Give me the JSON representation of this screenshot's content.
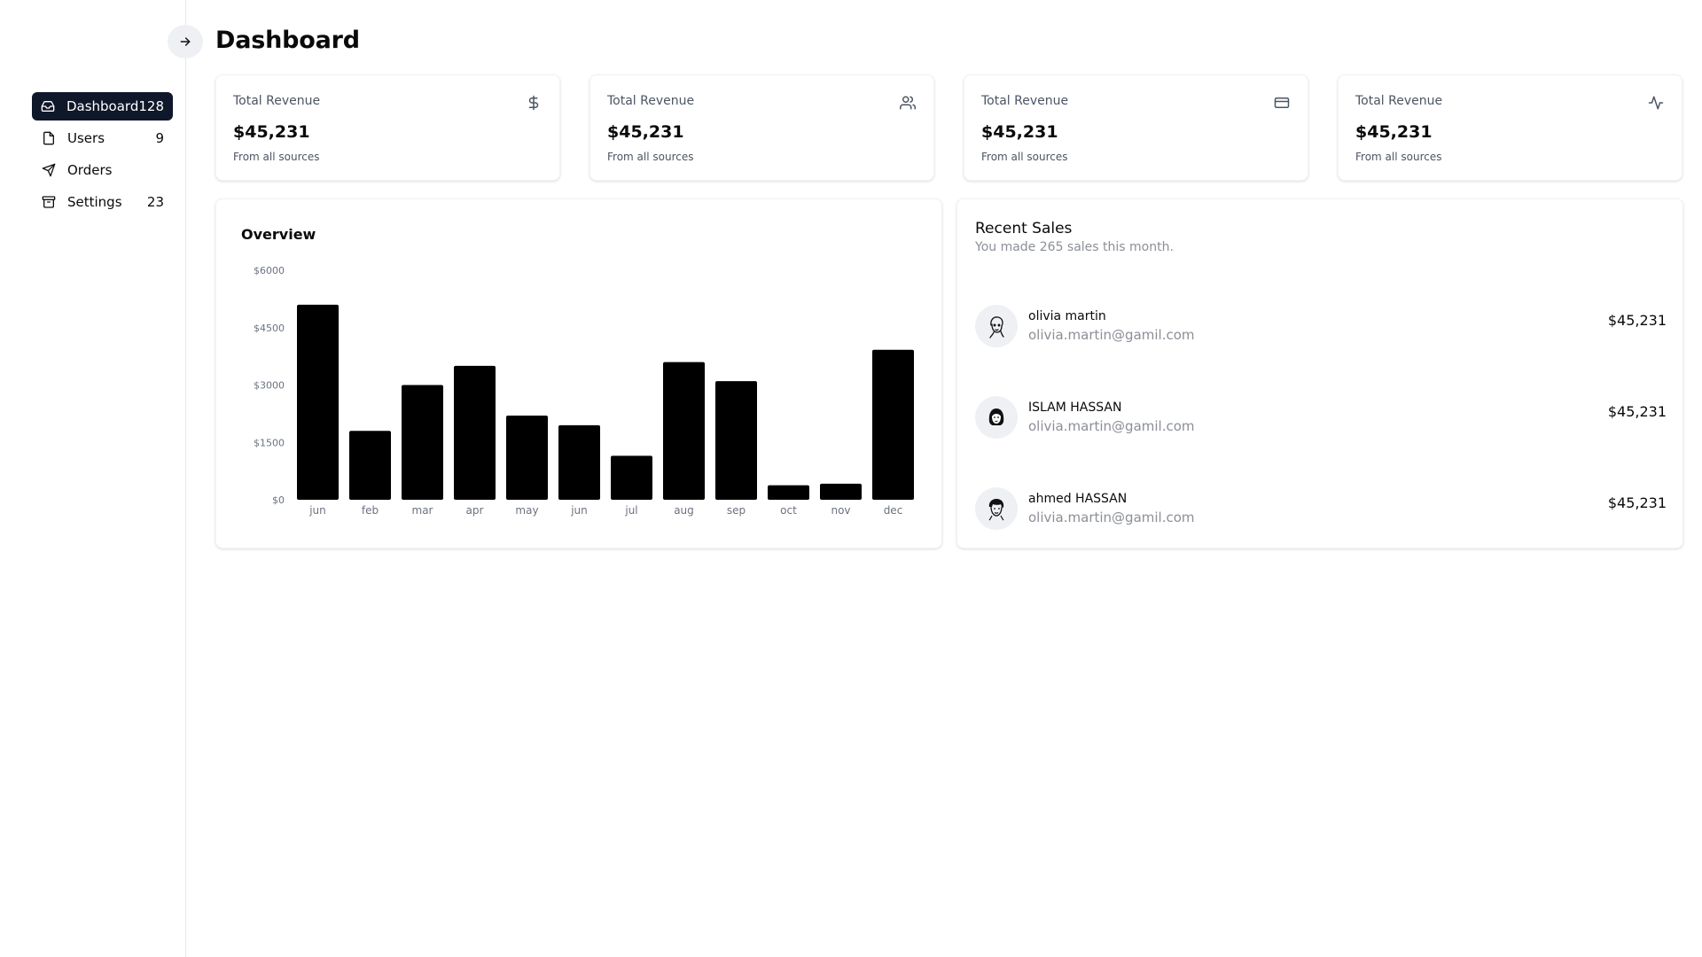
{
  "page": {
    "title": "Dashboard"
  },
  "sidebar": {
    "collapse_icon": "arrow-right-icon",
    "items": [
      {
        "label": "Dashboard",
        "count": "128",
        "icon": "inbox-icon",
        "active": true
      },
      {
        "label": "Users",
        "count": "9",
        "icon": "file-icon",
        "active": false
      },
      {
        "label": "Orders",
        "count": "",
        "icon": "send-icon",
        "active": false
      },
      {
        "label": "Settings",
        "count": "23",
        "icon": "archive-icon",
        "active": false
      }
    ]
  },
  "stats": [
    {
      "title": "Total Revenue",
      "value": "$45,231",
      "sub": "From all sources",
      "icon": "dollar-icon"
    },
    {
      "title": "Total Revenue",
      "value": "$45,231",
      "sub": "From all sources",
      "icon": "users-icon"
    },
    {
      "title": "Total Revenue",
      "value": "$45,231",
      "sub": "From all sources",
      "icon": "credit-card-icon"
    },
    {
      "title": "Total Revenue",
      "value": "$45,231",
      "sub": "From all sources",
      "icon": "activity-icon"
    }
  ],
  "overview": {
    "title": "Overview",
    "chart_data": {
      "type": "bar",
      "title": "Overview",
      "xlabel": "",
      "ylabel": "",
      "ylim": [
        0,
        6000
      ],
      "yticks": [
        "$0",
        "$1500",
        "$3000",
        "$4500",
        "$6000"
      ],
      "ytick_values": [
        0,
        1500,
        3000,
        4500,
        6000
      ],
      "categories": [
        "jun",
        "feb",
        "mar",
        "apr",
        "may",
        "jun",
        "jul",
        "aug",
        "sep",
        "oct",
        "nov",
        "dec"
      ],
      "values": [
        5100,
        1800,
        3000,
        3500,
        2200,
        1950,
        1150,
        3600,
        3100,
        380,
        420,
        3920
      ],
      "bar_color": "#000000",
      "grid": false
    }
  },
  "sales": {
    "title": "Recent Sales",
    "subtitle": "You made 265 sales this month.",
    "rows": [
      {
        "name": "olivia martin",
        "email": "olivia.martin@gamil.com",
        "amount": "$45,231",
        "avatar": "avatar-icon"
      },
      {
        "name": "ISLAM HASSAN",
        "email": "olivia.martin@gamil.com",
        "amount": "$45,231",
        "avatar": "avatar-icon"
      },
      {
        "name": "ahmed HASSAN",
        "email": "olivia.martin@gamil.com",
        "amount": "$45,231",
        "avatar": "avatar-icon"
      }
    ]
  },
  "colors": {
    "active_nav_bg": "#0f172a",
    "muted_text": "#8b8f96",
    "bar": "#000000"
  }
}
